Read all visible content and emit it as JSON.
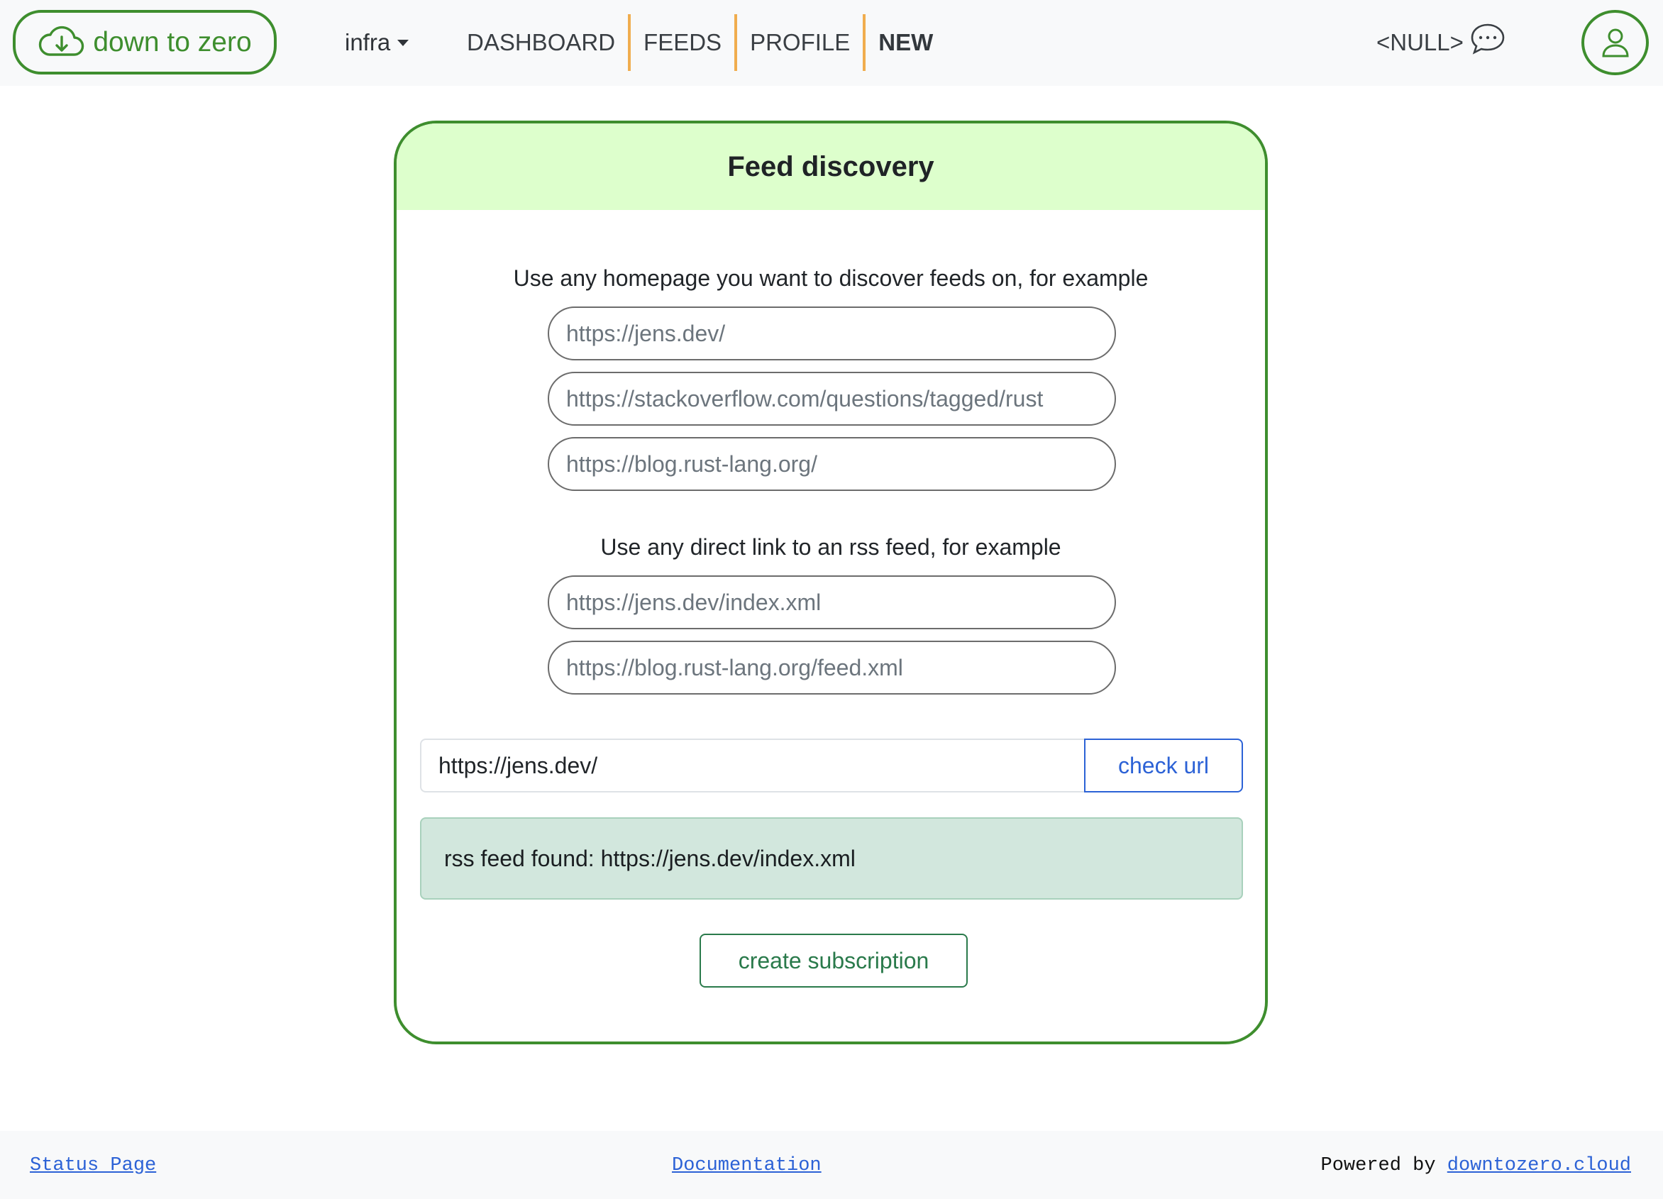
{
  "header": {
    "brand_label": "down to zero",
    "org_selector": "infra",
    "nav": {
      "dashboard": "DASHBOARD",
      "feeds": "FEEDS",
      "profile": "PROFILE",
      "new": "NEW"
    },
    "null_label": "<NULL>",
    "icons": {
      "brand": "cloud-download-icon",
      "feedback": "chat-dots-icon",
      "profile": "person-icon"
    }
  },
  "card": {
    "title": "Feed discovery",
    "homepage_hint": "Use any homepage you want to discover feeds on, for example",
    "homepage_examples": [
      "https://jens.dev/",
      "https://stackoverflow.com/questions/tagged/rust",
      "https://blog.rust-lang.org/"
    ],
    "rss_hint": "Use any direct link to an rss feed, for example",
    "rss_examples": [
      "https://jens.dev/index.xml",
      "https://blog.rust-lang.org/feed.xml"
    ],
    "url_input_value": "https://jens.dev/",
    "check_button_label": "check url",
    "result_message": "rss feed found: https://jens.dev/index.xml",
    "create_button_label": "create subscription"
  },
  "footer": {
    "status_link": "Status Page",
    "docs_link": "Documentation",
    "powered_by_text": "Powered by ",
    "powered_by_link": "downtozero.cloud"
  },
  "colors": {
    "brand_green": "#3e8e2e",
    "header_background": "#ddffcc",
    "nav_separator": "#f0ad4e",
    "link_blue": "#2c62d6",
    "success_background": "#d2e7dd",
    "success_button": "#2a7a4b"
  }
}
